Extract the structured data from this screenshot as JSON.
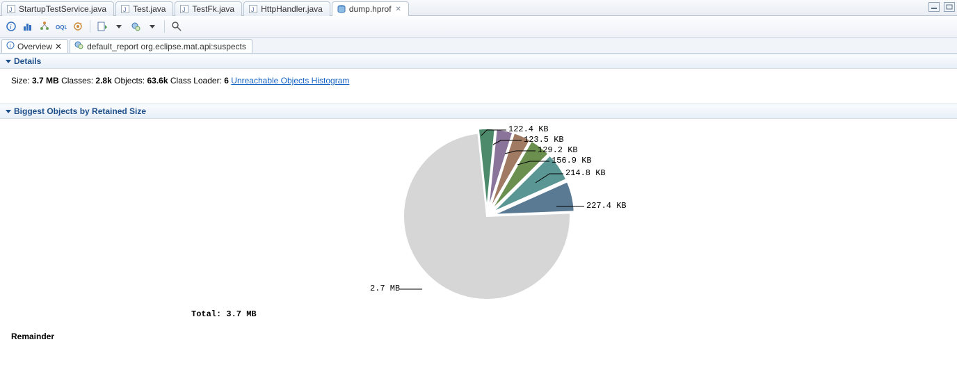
{
  "editor_tabs": [
    {
      "label": "StartupTestService.java",
      "type": "java"
    },
    {
      "label": "Test.java",
      "type": "java"
    },
    {
      "label": "TestFk.java",
      "type": "java"
    },
    {
      "label": "HttpHandler.java",
      "type": "java"
    },
    {
      "label": "dump.hprof",
      "type": "hprof",
      "active": true,
      "closable": true
    }
  ],
  "subtabs": [
    {
      "label": "Overview",
      "icon": "info",
      "active": true,
      "closable": true
    },
    {
      "label": "default_report  org.eclipse.mat.api:suspects",
      "icon": "report"
    }
  ],
  "sections": {
    "details": {
      "title": "Details",
      "size_label": "Size:",
      "size_value": "3.7 MB",
      "classes_label": "Classes:",
      "classes_value": "2.8k",
      "objects_label": "Objects:",
      "objects_value": "63.6k",
      "classloader_label": "Class Loader:",
      "classloader_value": "6",
      "unreachable_link": "Unreachable Objects Histogram"
    },
    "biggest": {
      "title": "Biggest Objects by Retained Size",
      "total_label": "Total: 3.7 MB",
      "remainder_label": "Remainder",
      "data_labels": {
        "s0": "122.4 KB",
        "s1": "123.5 KB",
        "s2": "129.2 KB",
        "s3": "156.9 KB",
        "s4": "214.8 KB",
        "s5": "227.4 KB",
        "remainder": "2.7 MB"
      }
    }
  },
  "chart_data": {
    "type": "pie",
    "title": "Biggest Objects by Retained Size",
    "total": "3.7 MB",
    "slices": [
      {
        "label": "122.4 KB",
        "value_kb": 122.4,
        "color": "#4c8a6b"
      },
      {
        "label": "123.5 KB",
        "value_kb": 123.5,
        "color": "#8b7499"
      },
      {
        "label": "129.2 KB",
        "value_kb": 129.2,
        "color": "#a07a63"
      },
      {
        "label": "156.9 KB",
        "value_kb": 156.9,
        "color": "#6a8f4f"
      },
      {
        "label": "214.8 KB",
        "value_kb": 214.8,
        "color": "#5a9694"
      },
      {
        "label": "227.4 KB",
        "value_kb": 227.4,
        "color": "#5a7a94"
      },
      {
        "label": "2.7 MB",
        "value_kb": 2764.8,
        "color": "#d6d6d6",
        "is_remainder": true
      }
    ]
  }
}
